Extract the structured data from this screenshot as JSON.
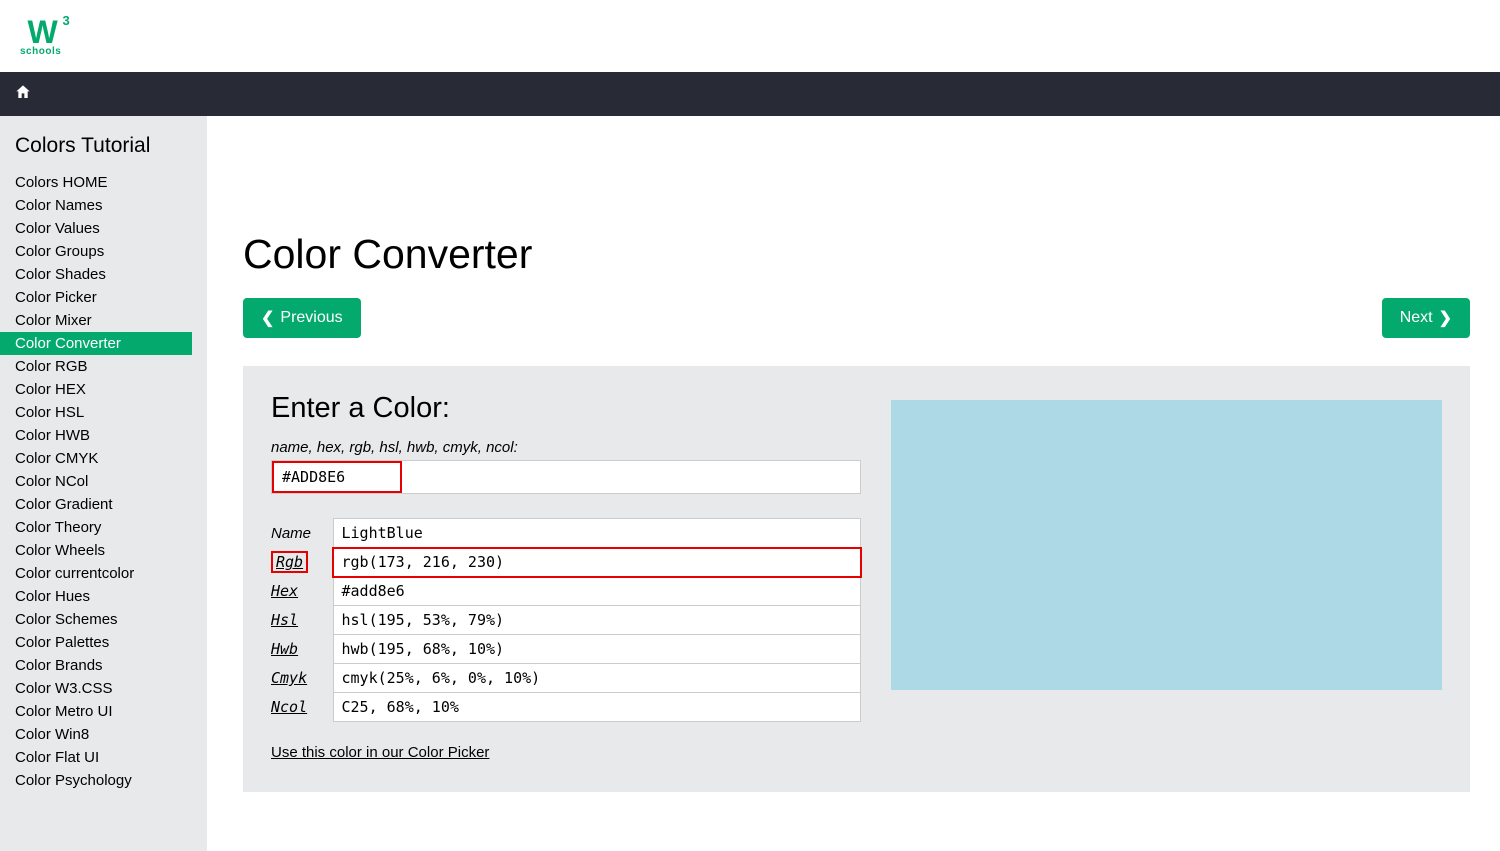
{
  "header": {
    "logo_text": "schools"
  },
  "sidebar": {
    "heading": "Colors Tutorial",
    "items": [
      {
        "label": "Colors HOME",
        "active": false
      },
      {
        "label": "Color Names",
        "active": false
      },
      {
        "label": "Color Values",
        "active": false
      },
      {
        "label": "Color Groups",
        "active": false
      },
      {
        "label": "Color Shades",
        "active": false
      },
      {
        "label": "Color Picker",
        "active": false
      },
      {
        "label": "Color Mixer",
        "active": false
      },
      {
        "label": "Color Converter",
        "active": true
      },
      {
        "label": "Color RGB",
        "active": false
      },
      {
        "label": "Color HEX",
        "active": false
      },
      {
        "label": "Color HSL",
        "active": false
      },
      {
        "label": "Color HWB",
        "active": false
      },
      {
        "label": "Color CMYK",
        "active": false
      },
      {
        "label": "Color NCol",
        "active": false
      },
      {
        "label": "Color Gradient",
        "active": false
      },
      {
        "label": "Color Theory",
        "active": false
      },
      {
        "label": "Color Wheels",
        "active": false
      },
      {
        "label": "Color currentcolor",
        "active": false
      },
      {
        "label": "Color Hues",
        "active": false
      },
      {
        "label": "Color Schemes",
        "active": false
      },
      {
        "label": "Color Palettes",
        "active": false
      },
      {
        "label": "Color Brands",
        "active": false
      },
      {
        "label": "Color W3.CSS",
        "active": false
      },
      {
        "label": "Color Metro UI",
        "active": false
      },
      {
        "label": "Color Win8",
        "active": false
      },
      {
        "label": "Color Flat UI",
        "active": false
      },
      {
        "label": "Color Psychology",
        "active": false
      }
    ]
  },
  "main": {
    "title": "Color Converter",
    "prev_label": "Previous",
    "next_label": "Next",
    "enter_title": "Enter a Color:",
    "hint": "name, hex, rgb, hsl, hwb, cmyk, ncol:",
    "input_value": "#ADD8E6",
    "results": {
      "name_label": "Name",
      "name_value": "LightBlue",
      "rows": [
        {
          "label": "Rgb",
          "value": "rgb(173, 216, 230)",
          "highlight": true
        },
        {
          "label": "Hex",
          "value": "#add8e6",
          "highlight": false
        },
        {
          "label": "Hsl",
          "value": "hsl(195, 53%, 79%)",
          "highlight": false
        },
        {
          "label": "Hwb",
          "value": "hwb(195, 68%, 10%)",
          "highlight": false
        },
        {
          "label": "Cmyk",
          "value": "cmyk(25%, 6%, 0%, 10%)",
          "highlight": false
        },
        {
          "label": "Ncol",
          "value": "C25, 68%, 10%",
          "highlight": false
        }
      ]
    },
    "preview_color": "#ADD8E6",
    "picker_link": "Use this color in our Color Picker"
  }
}
